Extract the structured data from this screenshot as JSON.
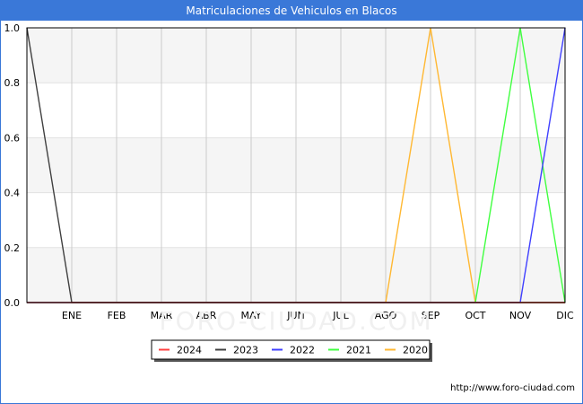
{
  "title": "Matriculaciones de Vehiculos en Blacos",
  "footer_url": "http://www.foro-ciudad.com",
  "watermark": "FORO-CIUDAD.COM",
  "colors": {
    "header_bg": "#3a78d8",
    "band_shade": "#f5f5f5",
    "grid": "#cccccc"
  },
  "chart_data": {
    "type": "line",
    "x": [
      "",
      "ENE",
      "FEB",
      "MAR",
      "ABR",
      "MAY",
      "JUN",
      "JUL",
      "AGO",
      "SEP",
      "OCT",
      "NOV",
      "DIC"
    ],
    "ylim": [
      0,
      1.0
    ],
    "yticks": [
      "0.0",
      "0.2",
      "0.4",
      "0.6",
      "0.8",
      "1.0"
    ],
    "grid": true,
    "legend_position": "bottom",
    "series": [
      {
        "name": "2024",
        "color": "#ff4040",
        "values": [
          0,
          0,
          0,
          0,
          0,
          0,
          0,
          0,
          0,
          0,
          0,
          0,
          0
        ]
      },
      {
        "name": "2023",
        "color": "#404040",
        "values": [
          1,
          0,
          0,
          0,
          0,
          0,
          0,
          0,
          0,
          0,
          0,
          0,
          0
        ]
      },
      {
        "name": "2022",
        "color": "#4040ff",
        "values": [
          0,
          0,
          0,
          0,
          0,
          0,
          0,
          0,
          0,
          0,
          0,
          0,
          1
        ]
      },
      {
        "name": "2021",
        "color": "#40ff40",
        "values": [
          0,
          0,
          0,
          0,
          0,
          0,
          0,
          0,
          0,
          0,
          0,
          1,
          0
        ]
      },
      {
        "name": "2020",
        "color": "#ffb833",
        "values": [
          0,
          0,
          0,
          0,
          0,
          0,
          0,
          0,
          0,
          1,
          0,
          0,
          0
        ]
      }
    ]
  }
}
